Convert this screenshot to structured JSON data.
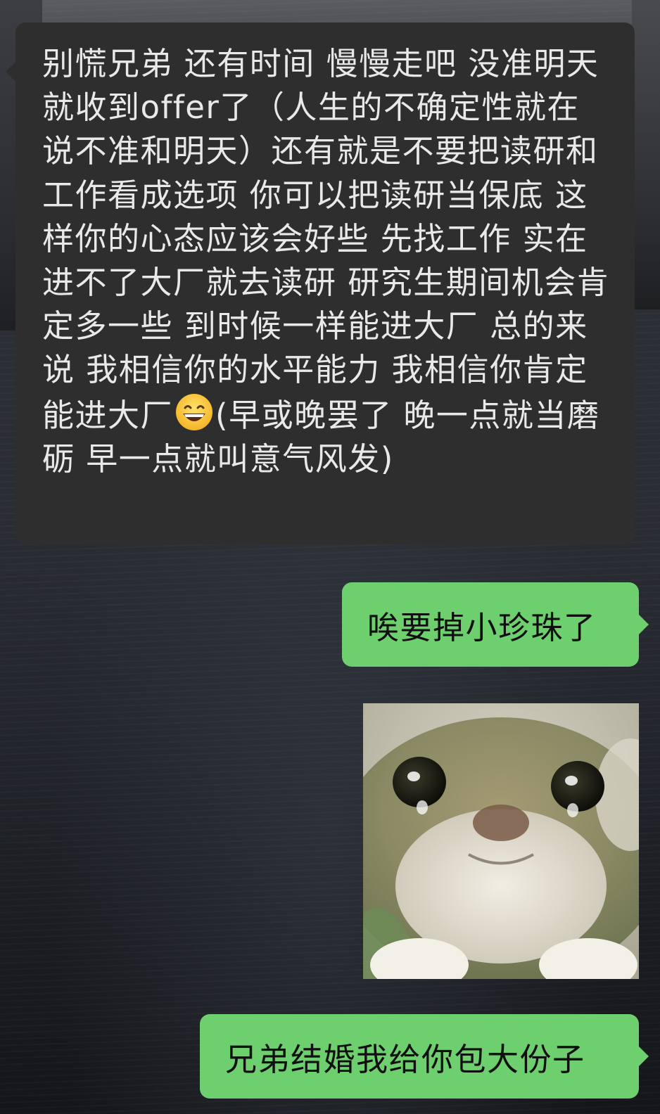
{
  "chat": {
    "messages": [
      {
        "side": "left",
        "text_before_emoji": "别慌兄弟 还有时间 慢慢走吧 没准明天就收到offer了（人生的不确定性就在说不准和明天）还有就是不要把读研和工作看成选项 你可以把读研当保底 这样你的心态应该会好些 先找工作 实在进不了大厂就去读研 研究生期间机会肯定多一些 到时候一样能进大厂 总的来说 我相信你的水平能力 我相信你肯定能进大厂",
        "emoji_icon": "grinning-sweat-face-emoji",
        "text_after_emoji": "(早或晚罢了 晚一点就当磨砺 早一点就叫意气风发)"
      },
      {
        "side": "right",
        "text": "唉要掉小珍珠了"
      },
      {
        "side": "right",
        "type": "sticker",
        "icon": "crying-cat-sticker"
      },
      {
        "side": "right",
        "text": "兄弟结婚我给你包大份子"
      }
    ]
  },
  "colors": {
    "incoming_bubble": "#2e2e2e",
    "incoming_text": "#e9e9e9",
    "outgoing_bubble": "#6ecf6e",
    "outgoing_text": "#0f0f0f"
  }
}
